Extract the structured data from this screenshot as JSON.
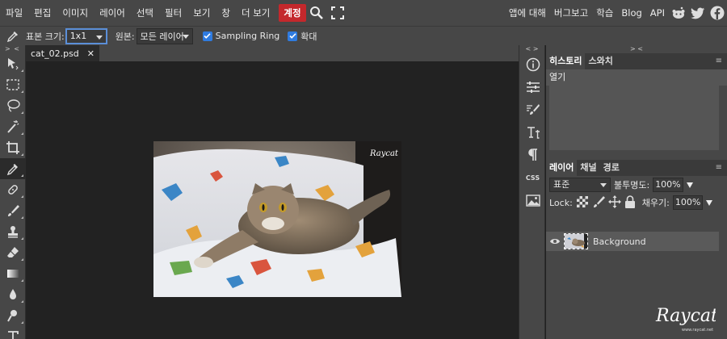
{
  "menu": {
    "items": [
      "파일",
      "편집",
      "이미지",
      "레이어",
      "선택",
      "필터",
      "보기",
      "창",
      "더 보기"
    ],
    "account": "계정",
    "right": [
      "앱에 대해",
      "버그보고",
      "학습",
      "Blog",
      "API"
    ]
  },
  "options": {
    "sample_size_label": "표본 크기:",
    "sample_size_value": "1x1",
    "source_label": "원본:",
    "source_value": "모든 레이어",
    "sampling_ring_label": "Sampling Ring",
    "zoom_label": "확대"
  },
  "document": {
    "tab_name": "cat_02.psd",
    "close_glyph": "✕"
  },
  "panels": {
    "history_tabs": [
      "히스토리",
      "스와치"
    ],
    "history_items": [
      "열기"
    ],
    "layers_tabs": [
      "레이어",
      "채널",
      "경로"
    ],
    "blend_mode": "표준",
    "opacity_label": "불투명도:",
    "opacity_value": "100%",
    "lock_label": "Lock:",
    "fill_label": "채우기:",
    "fill_value": "100%",
    "layer_name": "Background",
    "menu_glyph": "≡",
    "collapse_left": "> <",
    "collapse_right": "< >"
  },
  "canvas": {
    "signature": "Raycat"
  },
  "watermark": {
    "text": "Raycat",
    "sub": "www.raycat.net"
  },
  "colors": {
    "menubar": "#474747",
    "workspace": "#222222",
    "account": "#c4282c",
    "checkbox": "#2f7be0",
    "focus": "#5b8fd8"
  }
}
